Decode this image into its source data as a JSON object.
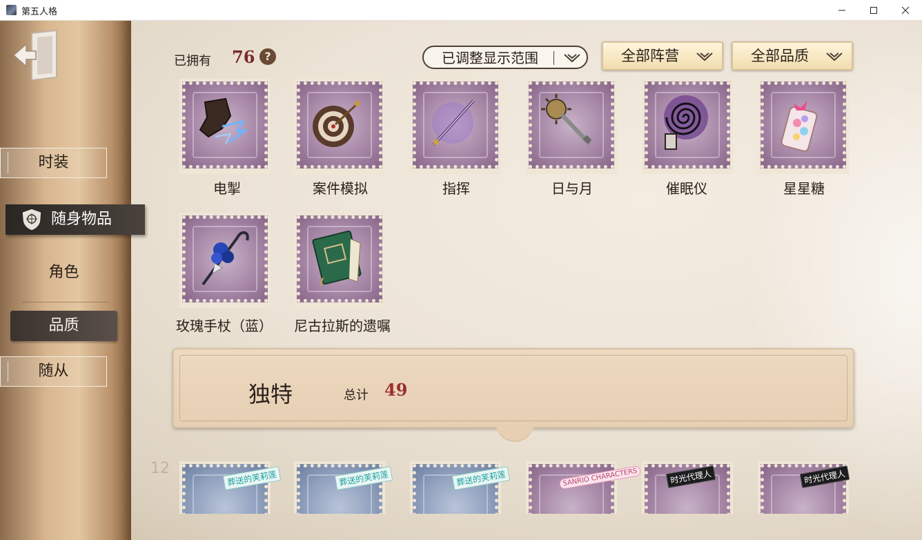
{
  "window": {
    "title": "第五人格"
  },
  "header": {
    "owned_label": "已拥有",
    "owned_count": "76",
    "help_glyph": "?",
    "filters": {
      "range": "已调整显示范围",
      "faction": "全部阵营",
      "quality": "全部品质"
    }
  },
  "sidebar": {
    "tabs": {
      "costume": "时装",
      "items": "随身物品",
      "follower": "随从"
    },
    "subtabs": {
      "role": "角色",
      "quality": "品质"
    }
  },
  "items": [
    {
      "name": "电掣"
    },
    {
      "name": "案件模拟"
    },
    {
      "name": "指挥"
    },
    {
      "name": "日与月"
    },
    {
      "name": "催眠仪"
    },
    {
      "name": "星星糖"
    },
    {
      "name": "玫瑰手杖（蓝）"
    },
    {
      "name": "尼古拉斯的遗嘱"
    }
  ],
  "section": {
    "title": "独特",
    "total_label": "总计",
    "total_count": "49"
  },
  "next_row_tags": [
    "葬送的芙莉莲",
    "葬送的芙莉莲",
    "葬送的芙莉莲",
    "SANRIO CHARACTERS",
    "时光代理人",
    "时光代理人"
  ],
  "background_number": "12"
}
